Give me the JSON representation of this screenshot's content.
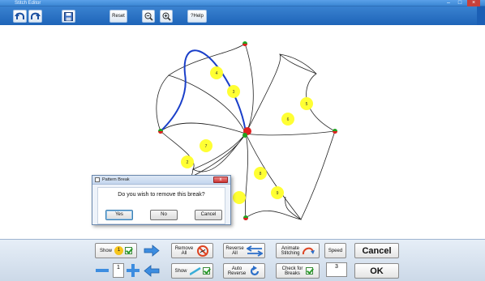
{
  "window": {
    "title": "Stitch Editor"
  },
  "toolbar": {
    "reset_label": "Reset",
    "help_label": "?Help"
  },
  "dialog": {
    "title": "Pattern Break",
    "message": "Do you wish to remove this break?",
    "yes_label": "Yes",
    "no_label": "No",
    "cancel_label": "Cancel",
    "close_symbol": "x"
  },
  "pattern": {
    "numbers": [
      "1",
      "2",
      "3",
      "4",
      "5",
      "6",
      "7",
      "8",
      "9"
    ],
    "colors": {
      "stitch_line": "#222222",
      "highlight_line": "#1a3fc9",
      "marker_fill": "#ffff33",
      "node_red": "#e02020",
      "node_green": "#1fa31f"
    }
  },
  "panel": {
    "show_label": "Show",
    "show_badge": "1",
    "remove_all_line1": "Remove",
    "remove_all_line2": "All",
    "reverse_all_line1": "Reverse",
    "reverse_all_line2": "All",
    "animate_line1": "Animate",
    "animate_line2": "Stitching",
    "speed_label": "Speed",
    "cancel_label": "Cancel",
    "step_value": "1",
    "show2_label": "Show",
    "auto_reverse_line1": "Auto",
    "auto_reverse_line2": "Reverse",
    "check_breaks_line1": "Check for",
    "check_breaks_line2": "Breaks",
    "speed_value": "3",
    "ok_label": "OK"
  },
  "colors": {
    "toolbar": "#1e64b8",
    "panel": "#d6e2ef",
    "accent_arrow": "#3d8de0"
  }
}
